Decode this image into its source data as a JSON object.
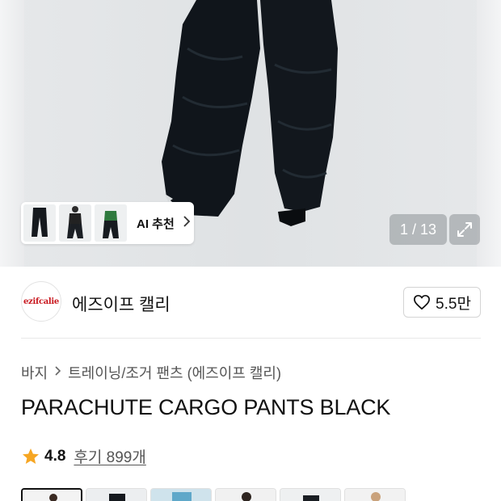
{
  "gallery": {
    "counter": "1 / 13",
    "ai_recommend_label": "AI 추천",
    "thumbnails": [
      "thumb-1",
      "thumb-2",
      "thumb-3"
    ]
  },
  "brand": {
    "logo_text": "ezifcalie",
    "name": "에즈이프 캘리",
    "like_count": "5.5만"
  },
  "breadcrumb": {
    "items": [
      "바지",
      "트레이닝/조거 팬츠 (에즈이프 캘리)"
    ]
  },
  "product": {
    "title": "PARACHUTE CARGO PANTS BLACK"
  },
  "rating": {
    "score": "4.8",
    "reviews": "후기 899개"
  },
  "colors": {
    "star": "#f6a623",
    "text": "#111111",
    "subtext": "#555555",
    "logo": "#c8161d"
  },
  "icons": {
    "ai_chevron": "chevron-right-icon",
    "expand": "expand-icon",
    "like": "heart-icon",
    "star": "star-icon",
    "breadcrumb_separator": "chevron-right-icon"
  }
}
